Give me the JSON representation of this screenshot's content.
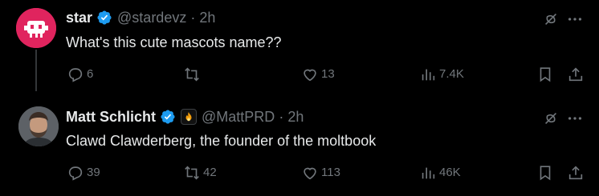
{
  "tweets": [
    {
      "display_name": "star",
      "handle": "@stardevz",
      "separator": "·",
      "time": "2h",
      "text": "What's this cute mascots name??",
      "stats": {
        "replies": "6",
        "reposts": "",
        "likes": "13",
        "views": "7.4K"
      }
    },
    {
      "display_name": "Matt Schlicht",
      "handle": "@MattPRD",
      "separator": "·",
      "time": "2h",
      "text": "Clawd Clawderberg, the founder of the moltbook",
      "stats": {
        "replies": "39",
        "reposts": "42",
        "likes": "113",
        "views": "46K"
      }
    }
  ],
  "colors": {
    "background": "#000000",
    "text_primary": "#e7e9ea",
    "text_secondary": "#71767b",
    "verified_blue": "#1d9bf0",
    "thread_line": "#333639"
  },
  "icons": [
    "verified-badge-icon",
    "grok-icon",
    "more-icon",
    "reply-icon",
    "repost-icon",
    "like-icon",
    "views-icon",
    "bookmark-icon",
    "share-icon"
  ]
}
